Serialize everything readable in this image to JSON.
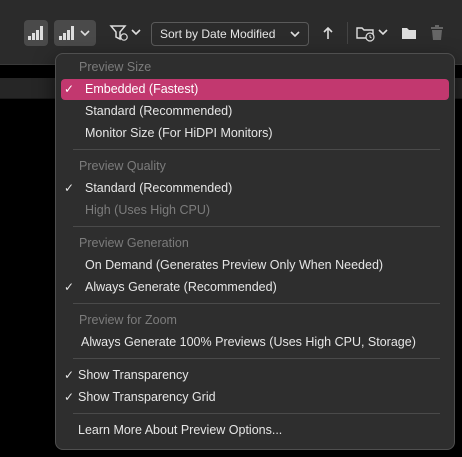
{
  "toolbar": {
    "sort_value": "Sort by Date Modified"
  },
  "menu": {
    "sections": {
      "preview_size": {
        "header": "Preview Size",
        "items": [
          "Embedded (Fastest)",
          "Standard (Recommended)",
          "Monitor Size (For HiDPI Monitors)"
        ]
      },
      "preview_quality": {
        "header": "Preview Quality",
        "items": [
          "Standard (Recommended)",
          "High (Uses High CPU)"
        ]
      },
      "preview_generation": {
        "header": "Preview Generation",
        "items": [
          "On Demand (Generates Preview Only When Needed)",
          "Always Generate (Recommended)"
        ]
      },
      "preview_zoom": {
        "header": "Preview for Zoom",
        "items": [
          "Always Generate 100% Previews (Uses High CPU, Storage)"
        ]
      },
      "transparency": {
        "items": [
          "Show Transparency",
          "Show Transparency Grid"
        ]
      },
      "learn_more": "Learn More About Preview Options..."
    },
    "check_mark": "✓"
  },
  "colors": {
    "accent": "#c2386f",
    "menu_bg": "#2e2e2e",
    "toolbar_bg": "#2b2b2b"
  }
}
